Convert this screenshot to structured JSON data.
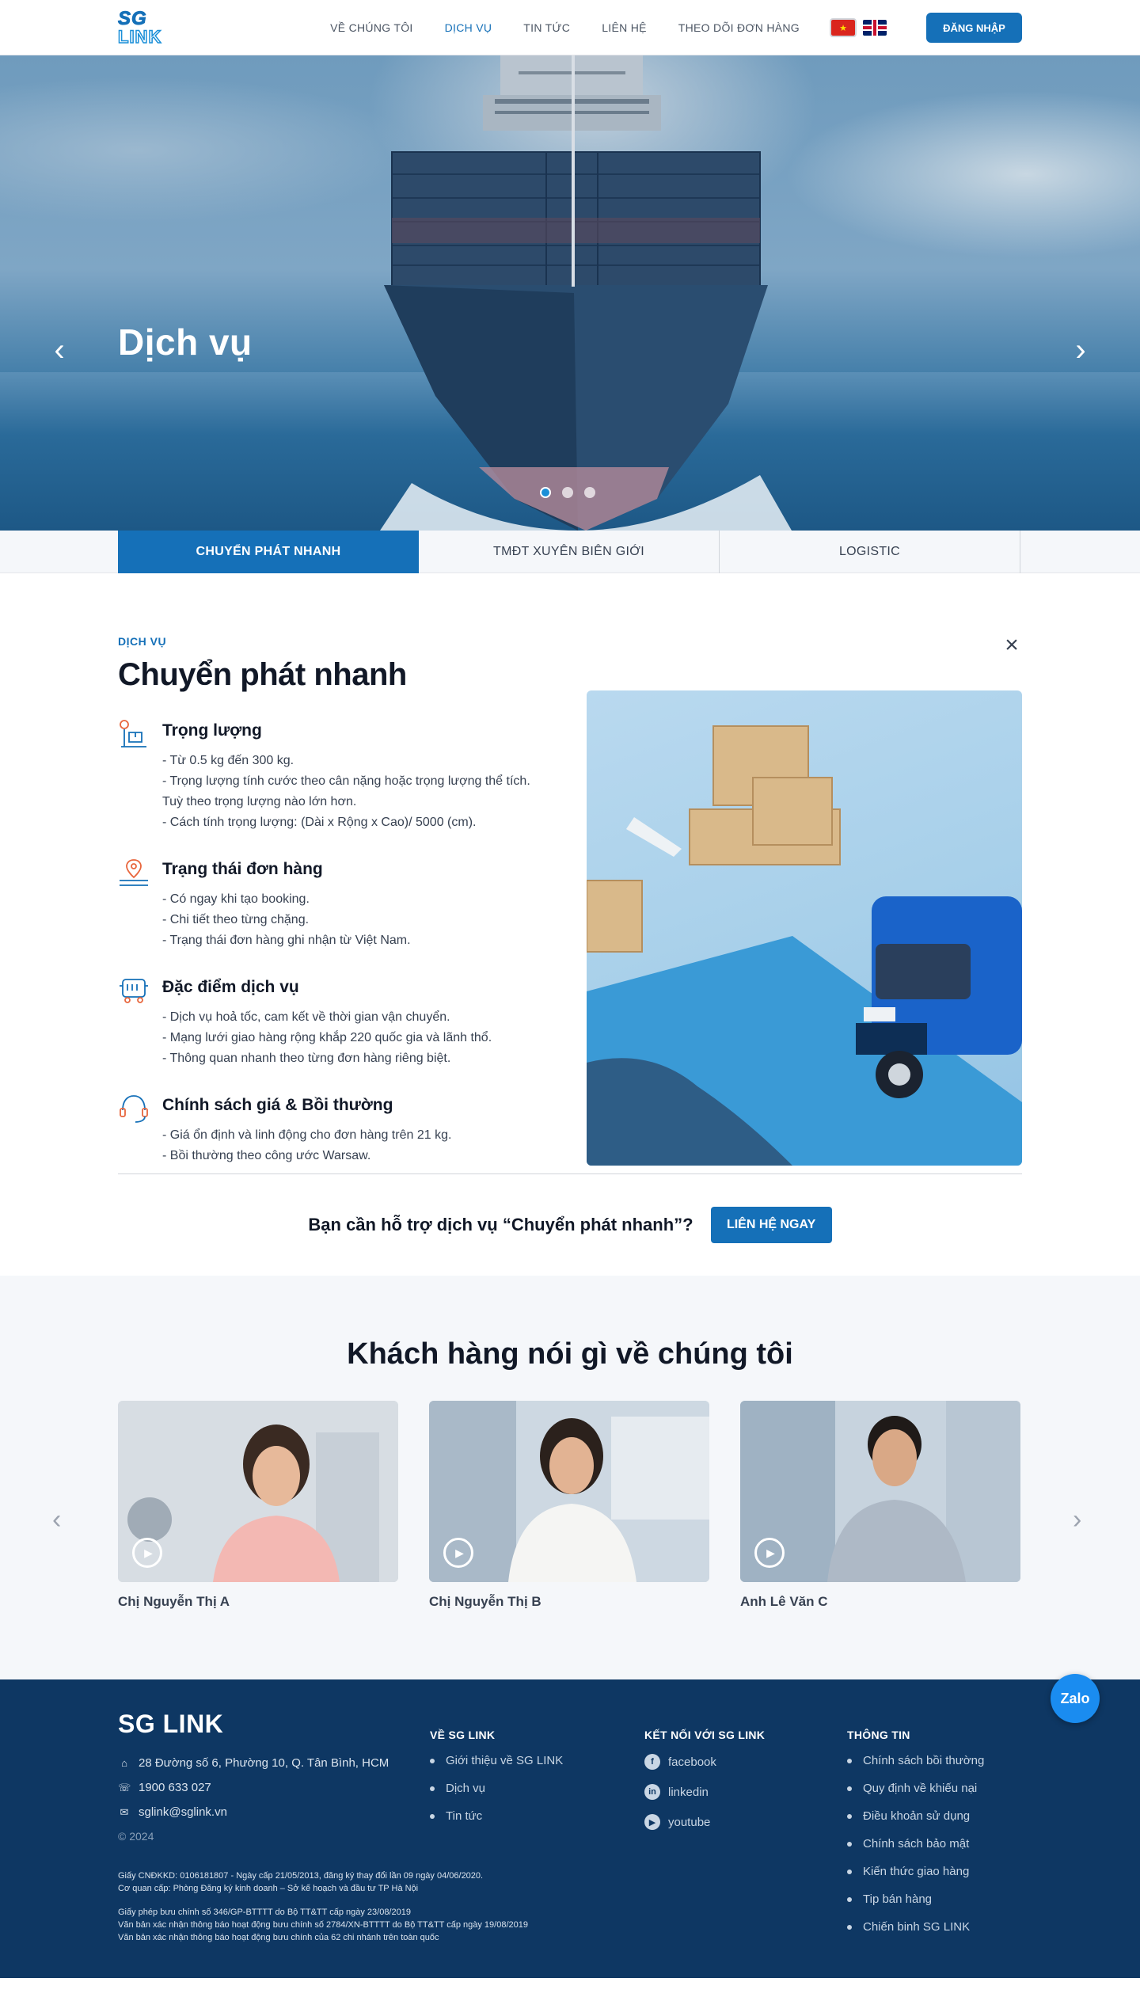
{
  "header": {
    "logo_line1": "SG",
    "logo_line2": "LINK",
    "nav": [
      "VỀ CHÚNG TÔI",
      "DỊCH VỤ",
      "TIN TỨC",
      "LIÊN HỆ",
      "THEO DÕI ĐƠN HÀNG"
    ],
    "login_label": "ĐĂNG NHẬP"
  },
  "hero": {
    "title": "Dịch vụ",
    "slides": 3,
    "active_slide": 1
  },
  "tabs": [
    "CHUYỂN PHÁT NHANH",
    "TMĐT XUYÊN BIÊN GIỚI",
    "LOGISTIC"
  ],
  "service": {
    "eyebrow": "DỊCH VỤ",
    "title": "Chuyển phát nhanh",
    "features": [
      {
        "icon": "scale-icon",
        "title": "Trọng lượng",
        "lines": [
          "- Từ 0.5 kg đến 300 kg.",
          "- Trọng lượng tính cước theo cân nặng hoặc trọng lượng thể tích. Tuỳ theo trọng lượng nào lớn hơn.",
          "- Cách tính trọng lượng: (Dài x Rộng x Cao)/ 5000 (cm)."
        ]
      },
      {
        "icon": "map-pin-icon",
        "title": "Trạng thái đơn hàng",
        "lines": [
          "- Có ngay khi tạo booking.",
          "- Chi tiết theo từng chặng.",
          "- Trạng thái đơn hàng ghi nhận từ Việt Nam."
        ]
      },
      {
        "icon": "truck-icon",
        "title": "Đặc điểm dịch vụ",
        "lines": [
          "- Dịch vụ hoả tốc, cam kết về thời gian vận chuyển.",
          "- Mạng lưới giao hàng rộng khắp 220 quốc gia và lãnh thổ.",
          "- Thông quan nhanh theo từng đơn hàng riêng biệt."
        ]
      },
      {
        "icon": "support-icon",
        "title": "Chính sách giá & Bồi thường",
        "lines": [
          "- Giá ổn định và linh động cho đơn hàng trên 21 kg.",
          "- Bồi thường theo công ước Warsaw."
        ]
      }
    ]
  },
  "cta": {
    "text": "Bạn cần hỗ trợ dịch vụ “Chuyển phát nhanh”?",
    "button": "LIÊN HỆ NGAY"
  },
  "testimonials": {
    "title": "Khách hàng nói gì về chúng tôi",
    "items": [
      {
        "name": "Chị Nguyễn Thị A"
      },
      {
        "name": "Chị Nguyễn Thị B"
      },
      {
        "name": "Anh Lê Văn C"
      }
    ]
  },
  "footer": {
    "brand": "SG LINK",
    "address": "28 Đường số 6, Phường 10, Q. Tân Bình, HCM",
    "phone": "1900 633 027",
    "email": "sglink@sglink.vn",
    "copyright": "© 2024",
    "legal": [
      "Giấy CNĐKKD: 0106181807 - Ngày cấp 21/05/2013, đăng ký thay đổi lần 09 ngày 04/06/2020.",
      "Cơ quan cấp: Phòng Đăng ký kinh doanh – Sở kế hoạch và đầu tư TP Hà Nội",
      "Giấy phép bưu chính số 346/GP-BTTTT do Bộ TT&TT cấp ngày 23/08/2019",
      "Văn bản xác nhận thông báo hoạt động bưu chính số 2784/XN-BTTTT do Bộ TT&TT cấp ngày 19/08/2019",
      "Văn bản xác nhận thông báo hoạt động bưu chính của 62 chi nhánh trên toàn quốc"
    ],
    "about": {
      "title": "VỀ SG LINK",
      "links": [
        "Giới thiệu về SG LINK",
        "Dịch vụ",
        "Tin tức"
      ]
    },
    "social": {
      "title": "KẾT NỐI VỚI SG LINK",
      "links": [
        "facebook",
        "linkedin",
        "youtube"
      ]
    },
    "info": {
      "title": "THÔNG TIN",
      "links": [
        "Chính sách bồi thường",
        "Quy định về khiếu nại",
        "Điều khoản sử dụng",
        "Chính sách bảo mật",
        "Kiến thức giao hàng",
        "Tip bán hàng",
        "Chiến binh SG LINK"
      ]
    }
  },
  "zalo": "Zalo",
  "colors": {
    "primary": "#1570b8",
    "footer_bg": "#0e3763",
    "zalo": "#1a8cf0"
  }
}
